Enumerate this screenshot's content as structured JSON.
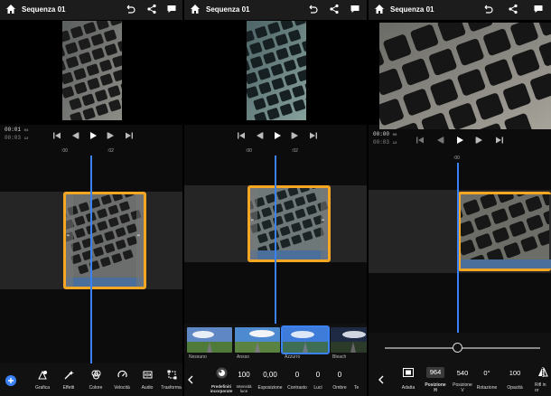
{
  "project": {
    "title": "Sequenza 01"
  },
  "panel1": {
    "timecode_main": "00:01",
    "timecode_main_frames": "04",
    "timecode_total": "00:03",
    "timecode_total_frames": "12",
    "ruler": [
      ":00",
      ":02"
    ],
    "toolbar": [
      {
        "icon": "add-icon",
        "label": ""
      },
      {
        "icon": "graphics-icon",
        "label": "Grafica"
      },
      {
        "icon": "effects-icon",
        "label": "Effetti"
      },
      {
        "icon": "color-icon",
        "label": "Colore"
      },
      {
        "icon": "speed-icon",
        "label": "Velocità"
      },
      {
        "icon": "audio-icon",
        "label": "Audio"
      },
      {
        "icon": "transform-icon",
        "label": "Trasforma"
      }
    ]
  },
  "panel2": {
    "ruler": [
      ":00",
      ":02"
    ],
    "presets": [
      "Nessuno",
      "Ansso",
      "Azzurro",
      "Bleach"
    ],
    "adjustments": [
      {
        "value": "",
        "label": "Predefiniti incorporate"
      },
      {
        "value": "100",
        "label": "Intensità luce"
      },
      {
        "value": "0,00",
        "label": "Esposizione"
      },
      {
        "value": "0",
        "label": "Contrasto"
      },
      {
        "value": "0",
        "label": "Luci"
      },
      {
        "value": "0",
        "label": "Ombre"
      },
      {
        "value": "",
        "label": "Te"
      }
    ]
  },
  "panel3": {
    "timecode_main": "00:00",
    "timecode_main_frames": "00",
    "timecode_total": "00:03",
    "timecode_total_frames": "12",
    "ruler": [
      ":00"
    ],
    "slider_value": 0.47,
    "transform": [
      {
        "value": "",
        "label": "Adatta"
      },
      {
        "value": "964",
        "label": "Posizione H"
      },
      {
        "value": "540",
        "label": "Posizione V"
      },
      {
        "value": "0°",
        "label": "Rotazione"
      },
      {
        "value": "100",
        "label": "Opacità"
      },
      {
        "value": "",
        "label": "Rifl in or"
      }
    ]
  },
  "colors": {
    "accent": "#3a82f5",
    "clip_border": "#f5a623",
    "waveform": "#4a6f9a"
  }
}
